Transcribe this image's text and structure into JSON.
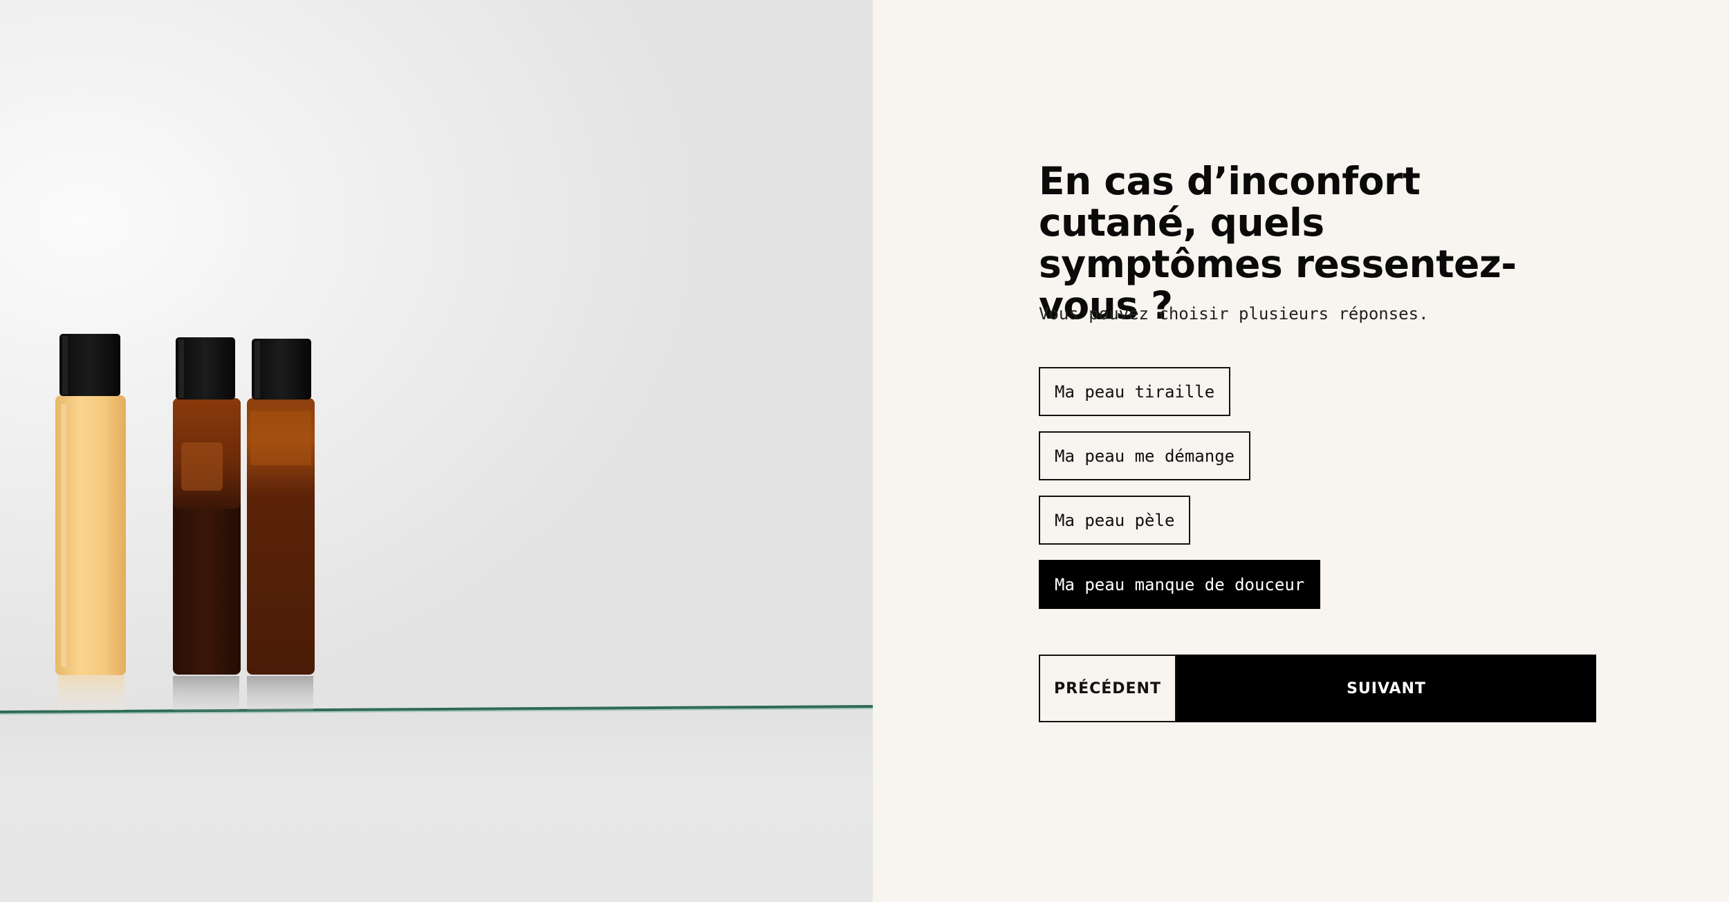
{
  "quiz": {
    "question": "En cas d’inconfort cutané, quels symptômes ressentez-vous ?",
    "hint": "Vous pouvez choisir plusieurs réponses.",
    "options": [
      {
        "label": "Ma peau tiraille",
        "selected": false
      },
      {
        "label": "Ma peau me démange",
        "selected": false
      },
      {
        "label": "Ma peau pèle",
        "selected": false
      },
      {
        "label": "Ma peau manque de douceur",
        "selected": true
      }
    ],
    "nav": {
      "prev_label": "PRÉCÉDENT",
      "next_label": "SUIVANT"
    }
  },
  "colors": {
    "panel_bg": "#f8f4ef",
    "ink": "#000000",
    "selected_bg": "#000000",
    "selected_text": "#ffffff"
  }
}
